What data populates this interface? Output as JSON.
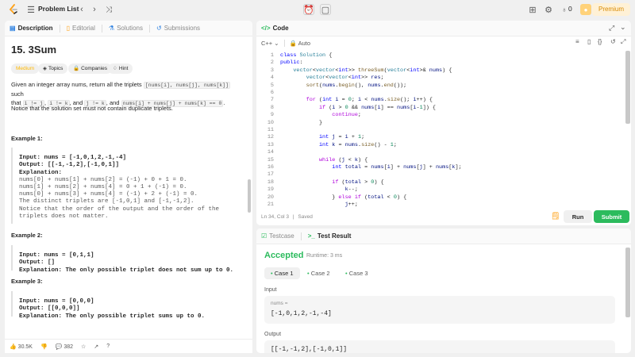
{
  "topbar": {
    "problem_list": "Problem List",
    "streak_count": "0",
    "premium": "Premium"
  },
  "left": {
    "tabs": [
      "Description",
      "Editorial",
      "Solutions",
      "Submissions"
    ],
    "title": "15. 3Sum",
    "tags": [
      "Medium",
      "Topics",
      "Companies",
      "Hint"
    ],
    "desc_p1_a": "Given an integer array nums, return all the triplets",
    "desc_p1_c1": "[nums[i], nums[j], nums[k]]",
    "desc_p1_b": "such",
    "desc_p2_a": "that",
    "desc_p2_c1": "i != j",
    "desc_p2_c2": "i != k",
    "desc_p2_c3": "j != k",
    "desc_p2_c4": "nums[i] + nums[j] + nums[k] == 0",
    "desc_p2_and": "and",
    "desc_p3": "Notice that the solution set must not contain duplicate triplets.",
    "examples": [
      {
        "title": "Example 1:",
        "lines": [
          "Input: nums = [-1,0,1,2,-1,-4]",
          "Output: [[-1,-1,2],[-1,0,1]]",
          "Explanation:",
          "nums[0] + nums[1] + nums[2] = (-1) + 0 + 1 = 0.",
          "nums[1] + nums[2] + nums[4] = 0 + 1 + (-1) = 0.",
          "nums[0] + nums[3] + nums[4] = (-1) + 2 + (-1) = 0.",
          "The distinct triplets are [-1,0,1] and [-1,-1,2].",
          "Notice that the order of the output and the order of the",
          "triplets does not matter."
        ]
      },
      {
        "title": "Example 2:",
        "lines": [
          "Input: nums = [0,1,1]",
          "Output: []",
          "Explanation: The only possible triplet does not sum up to 0."
        ]
      },
      {
        "title": "Example 3:",
        "lines": [
          "Input: nums = [0,0,0]",
          "Output: [[0,0,0]]",
          "Explanation: The only possible triplet sums up to 0."
        ]
      }
    ],
    "likes": "30.5K",
    "comments": "382"
  },
  "code": {
    "tab": "Code",
    "lang": "C++",
    "auto": "Auto",
    "status_pos": "Ln 34, Col 3",
    "status_saved": "Saved",
    "run": "Run",
    "submit": "Submit",
    "lines": [
      "class Solution {",
      "public:",
      "    vector<vector<int>> threeSum(vector<int>& nums) {",
      "        vector<vector<int>> res;",
      "        sort(nums.begin(), nums.end());",
      "",
      "        for (int i = 0; i < nums.size(); i++) {",
      "            if (i > 0 && nums[i] == nums[i-1]) {",
      "                continue;",
      "            }",
      "",
      "            int j = i + 1;",
      "            int k = nums.size() - 1;",
      "",
      "            while (j < k) {",
      "                int total = nums[i] + nums[j] + nums[k];",
      "",
      "                if (total > 0) {",
      "                    k--;",
      "                } else if (total < 0) {",
      "                    j++;"
    ]
  },
  "result": {
    "tabs": [
      "Testcase",
      "Test Result"
    ],
    "status": "Accepted",
    "runtime": "Runtime: 3 ms",
    "cases": [
      "Case 1",
      "Case 2",
      "Case 3"
    ],
    "input_label": "Input",
    "input_var": "nums =",
    "input_value": "[-1,0,1,2,-1,-4]",
    "output_label": "Output",
    "output_value": "[[-1,-1,2],[-1,0,1]]"
  },
  "colors": {
    "accent_green": "#2cbb5d",
    "accent_orange": "#ffa116",
    "medium": "#ffb800"
  }
}
